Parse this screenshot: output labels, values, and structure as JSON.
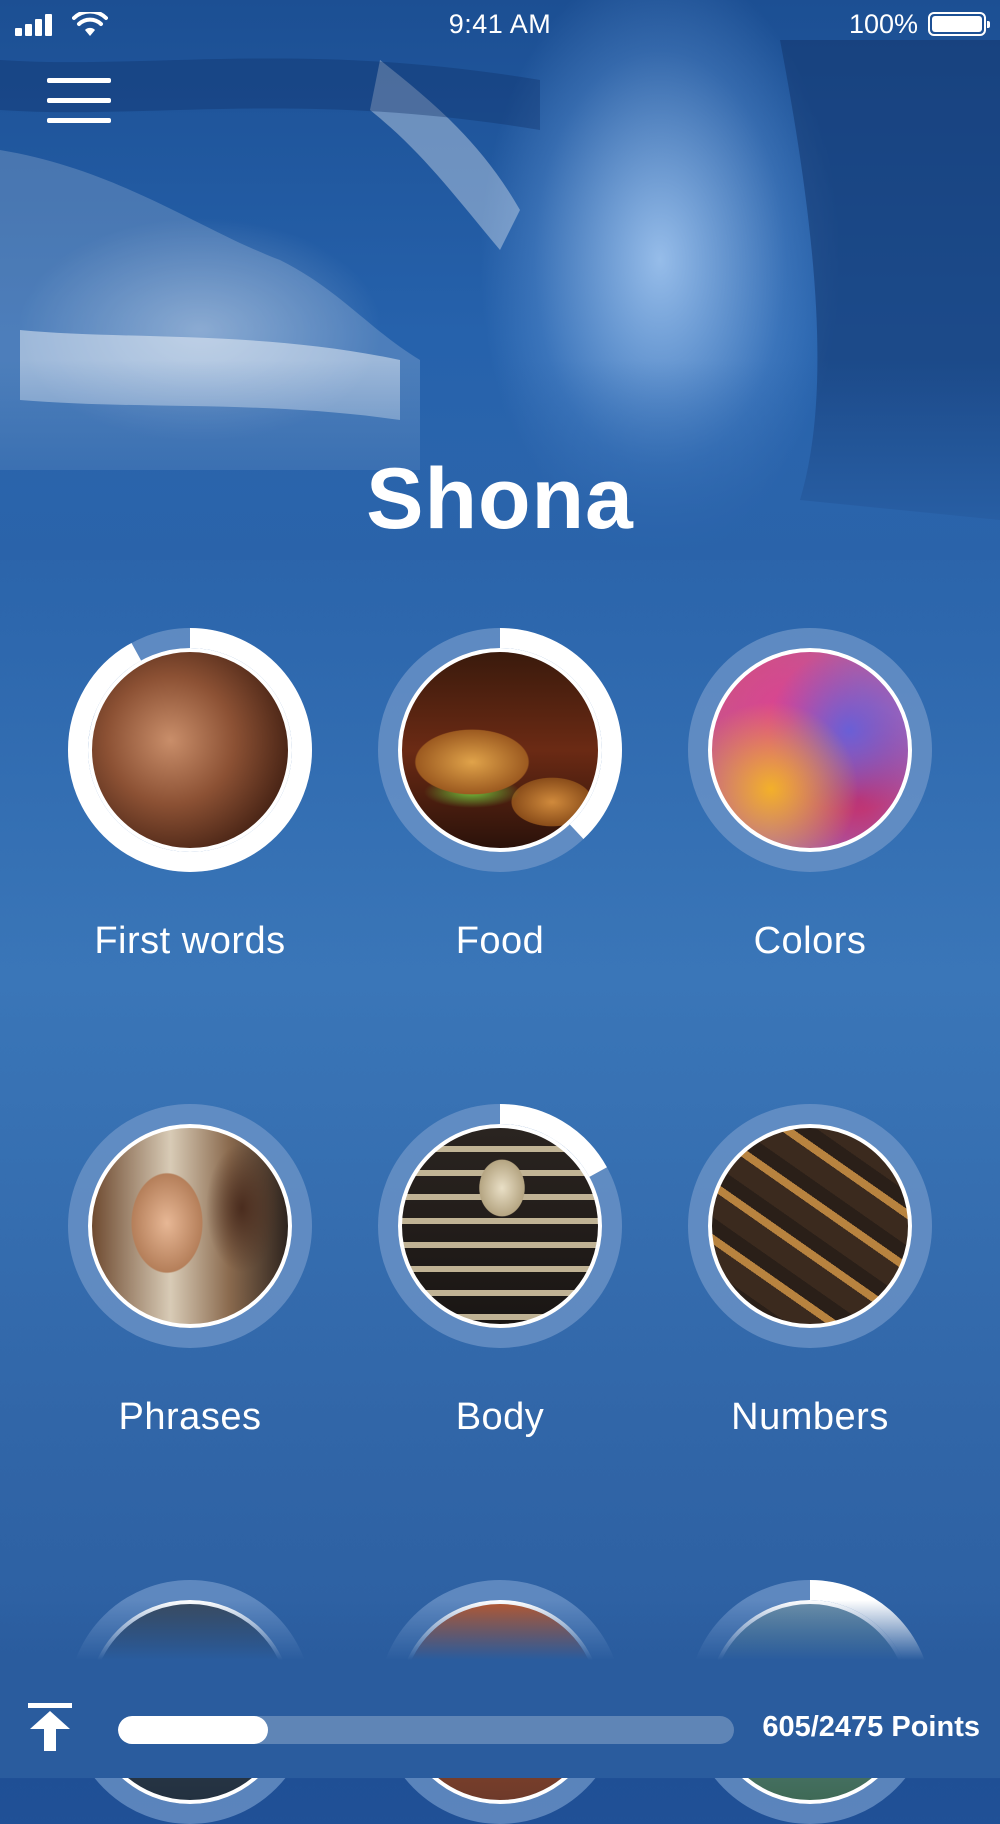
{
  "status_bar": {
    "time": "9:41 AM",
    "battery": "100%"
  },
  "header": {
    "menu_icon": "hamburger-menu-icon",
    "title": "Shona"
  },
  "categories": [
    {
      "label": "First words",
      "progress": 0.92,
      "image": "baby-face"
    },
    {
      "label": "Food",
      "progress": 0.38,
      "image": "burger-and-cola"
    },
    {
      "label": "Colors",
      "progress": 0,
      "image": "color-powder"
    },
    {
      "label": "Phrases",
      "progress": 0,
      "image": "smiling-couple"
    },
    {
      "label": "Body",
      "progress": 0.17,
      "image": "skeleton"
    },
    {
      "label": "Numbers",
      "progress": 0,
      "image": "wooden-type-numbers"
    },
    {
      "label": "",
      "progress": 0,
      "image": "headphones"
    },
    {
      "label": "",
      "progress": 0,
      "image": "sunset"
    },
    {
      "label": "",
      "progress": 0.3,
      "image": "nature"
    }
  ],
  "footer": {
    "upload_icon": "scroll-to-top-icon",
    "progress": 0.244,
    "points_text": "605/2475 Points"
  },
  "colors": {
    "ring_track": "#6f95c8",
    "ring_fill": "#ffffff"
  }
}
